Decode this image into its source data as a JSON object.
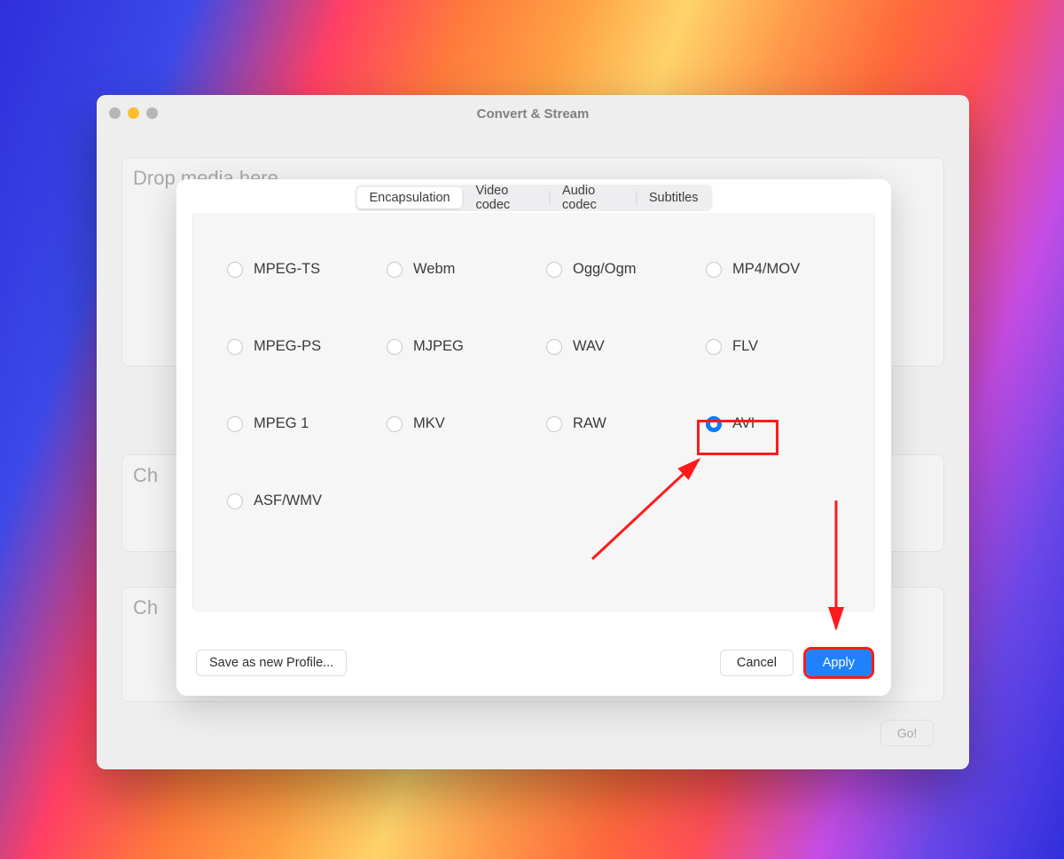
{
  "window": {
    "title": "Convert & Stream",
    "bg_labels": {
      "drop": "Drop media here",
      "ch1": "Ch",
      "ch2": "Ch"
    },
    "go_label": "Go!"
  },
  "sheet": {
    "tabs": [
      {
        "label": "Encapsulation",
        "active": true
      },
      {
        "label": "Video codec",
        "active": false
      },
      {
        "label": "Audio codec",
        "active": false
      },
      {
        "label": "Subtitles",
        "active": false
      }
    ],
    "radios": {
      "selected": "AVI",
      "items": [
        "MPEG-TS",
        "Webm",
        "Ogg/Ogm",
        "MP4/MOV",
        "MPEG-PS",
        "MJPEG",
        "WAV",
        "FLV",
        "MPEG 1",
        "MKV",
        "RAW",
        "AVI",
        "ASF/WMV"
      ]
    },
    "buttons": {
      "save": "Save as new Profile...",
      "cancel": "Cancel",
      "apply": "Apply"
    }
  },
  "annotations": {
    "highlight_radio": "AVI",
    "highlight_button": "apply"
  },
  "colors": {
    "accent": "#0a7bff",
    "apply_bg": "#1e82ff",
    "annotation_red": "#ff1b1b"
  }
}
